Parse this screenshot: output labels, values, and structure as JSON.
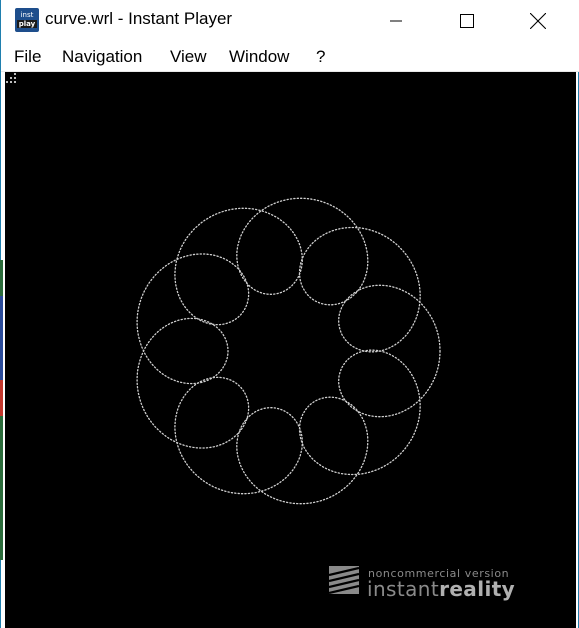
{
  "window": {
    "title": "curve.wrl - Instant Player",
    "icon": {
      "top": "inst",
      "bottom": "play"
    }
  },
  "controls": {
    "minimize": "minimize-icon",
    "maximize": "maximize-icon",
    "close": "close-icon"
  },
  "menu": {
    "file": "File",
    "navigation": "Navigation",
    "view": "View",
    "window": "Window",
    "help": "?"
  },
  "viewport": {
    "background": "#000000",
    "curve_color": "#cfcfcf",
    "loops": 10
  },
  "watermark": {
    "line1": "noncommercial version",
    "brand_light": "instant",
    "brand_bold": "reality"
  }
}
